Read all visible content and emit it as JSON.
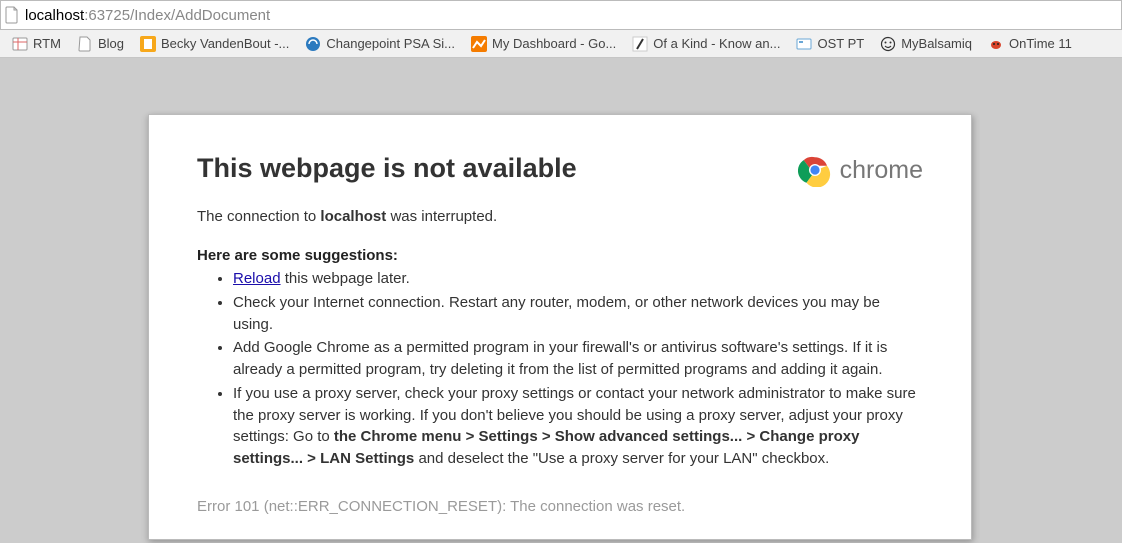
{
  "address": {
    "host": "localhost",
    "rest": ":63725/Index/AddDocument"
  },
  "bookmarks": [
    {
      "label": "RTM"
    },
    {
      "label": "Blog"
    },
    {
      "label": "Becky VandenBout -..."
    },
    {
      "label": "Changepoint PSA Si..."
    },
    {
      "label": "My Dashboard - Go..."
    },
    {
      "label": "Of a Kind - Know an..."
    },
    {
      "label": "OST PT"
    },
    {
      "label": "MyBalsamiq"
    },
    {
      "label": "OnTime 11"
    }
  ],
  "error": {
    "title": "This webpage is not available",
    "connection_prefix": "The connection to ",
    "connection_host": "localhost",
    "connection_suffix": " was interrupted.",
    "suggestions_heading": "Here are some suggestions:",
    "reload_text": "Reload",
    "s1_suffix": " this webpage later.",
    "s2": "Check your Internet connection. Restart any router, modem, or other network devices you may be using.",
    "s3": "Add Google Chrome as a permitted program in your firewall's or antivirus software's settings. If it is already a permitted program, try deleting it from the list of permitted programs and adding it again.",
    "s4_a": "If you use a proxy server, check your proxy settings or contact your network administrator to make sure the proxy server is working. If you don't believe you should be using a proxy server, adjust your proxy settings: Go to ",
    "s4_bold": "the Chrome menu > Settings > Show advanced settings... > Change proxy settings... > LAN Settings",
    "s4_b": " and deselect the \"Use a proxy server for your LAN\" checkbox.",
    "error_code": "Error 101 (net::ERR_CONNECTION_RESET): The connection was reset."
  },
  "brand": {
    "name": "chrome"
  }
}
